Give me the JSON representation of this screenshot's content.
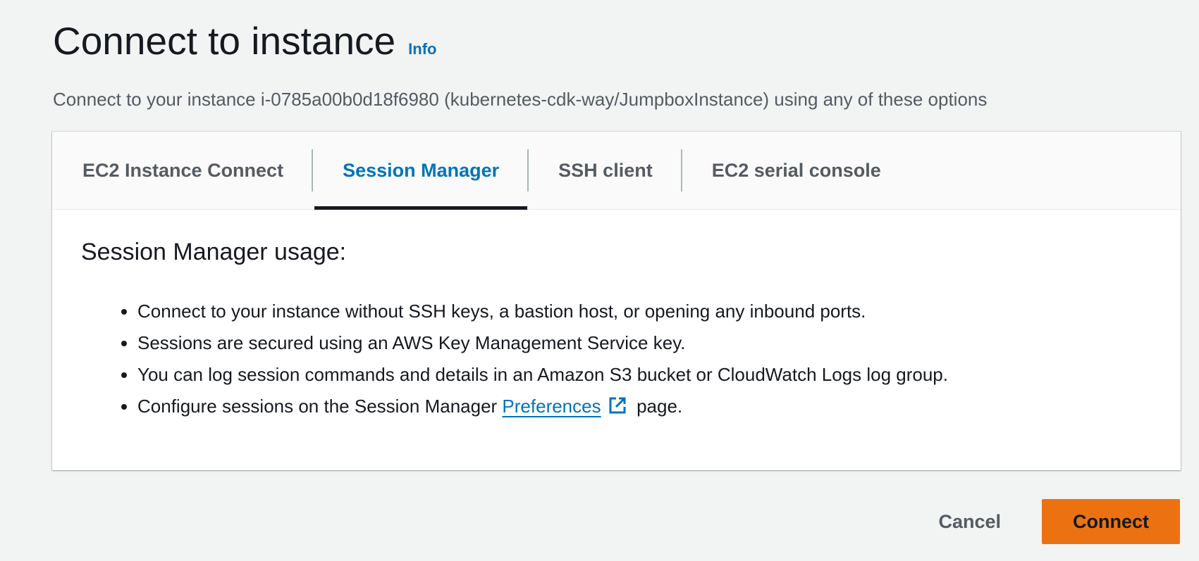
{
  "header": {
    "title": "Connect to instance",
    "info_label": "Info",
    "subtitle": "Connect to your instance i-0785a00b0d18f6980 (kubernetes-cdk-way/JumpboxInstance) using any of these options"
  },
  "tabs": [
    {
      "label": "EC2 Instance Connect",
      "active": false
    },
    {
      "label": "Session Manager",
      "active": true
    },
    {
      "label": "SSH client",
      "active": false
    },
    {
      "label": "EC2 serial console",
      "active": false
    }
  ],
  "content": {
    "heading": "Session Manager usage:",
    "bullets": [
      "Connect to your instance without SSH keys, a bastion host, or opening any inbound ports.",
      "Sessions are secured using an AWS Key Management Service key.",
      "You can log session commands and details in an Amazon S3 bucket or CloudWatch Logs log group."
    ],
    "last_bullet": {
      "prefix": "Configure sessions on the Session Manager",
      "link_label": "Preferences",
      "link_icon": "external-link-icon",
      "suffix": "page."
    }
  },
  "footer": {
    "cancel_label": "Cancel",
    "connect_label": "Connect"
  },
  "colors": {
    "accent": "#0073bb",
    "primary_button": "#ec7211",
    "background": "#f2f3f3"
  }
}
